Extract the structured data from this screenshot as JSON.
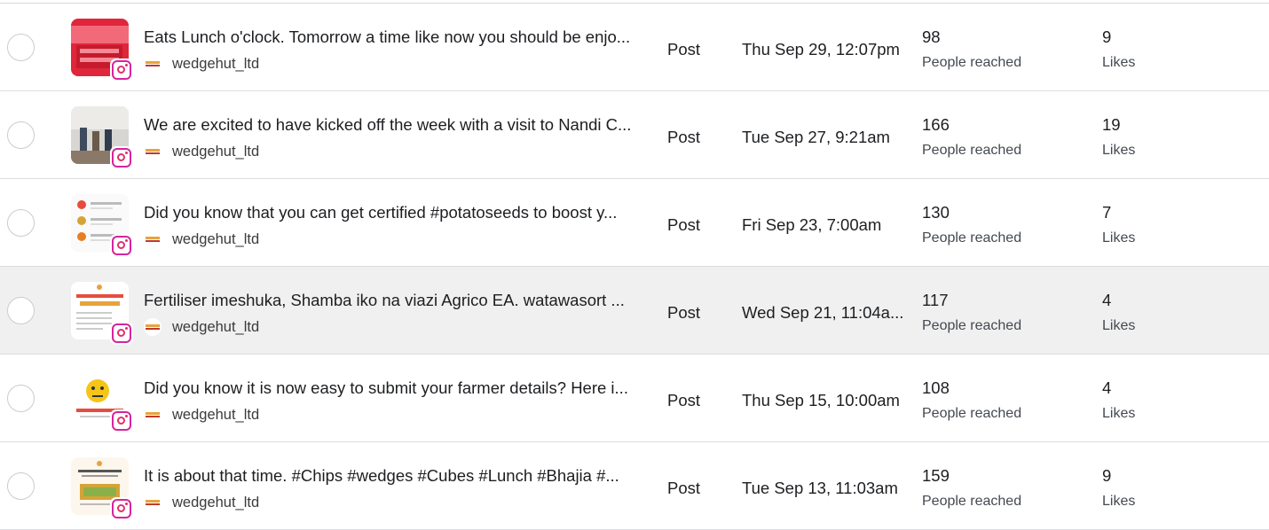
{
  "rows": [
    {
      "caption": "Eats Lunch o'clock. Tomorrow a time like now you should be enjo...",
      "account": "wedgehut_ltd",
      "type": "Post",
      "date": "Thu Sep 29, 12:07pm",
      "reach": "98",
      "reach_label": "People reached",
      "likes": "9",
      "likes_label": "Likes",
      "thumb": "thumb-red-crates",
      "highlight": false
    },
    {
      "caption": "We are excited to have kicked off the week with a visit to Nandi C...",
      "account": "wedgehut_ltd",
      "type": "Post",
      "date": "Tue Sep 27, 9:21am",
      "reach": "166",
      "reach_label": "People reached",
      "likes": "19",
      "likes_label": "Likes",
      "thumb": "thumb-room-visit",
      "highlight": false
    },
    {
      "caption": "Did you know that you can get certified #potatoseeds to boost y...",
      "account": "wedgehut_ltd",
      "type": "Post",
      "date": "Fri Sep 23, 7:00am",
      "reach": "130",
      "reach_label": "People reached",
      "likes": "7",
      "likes_label": "Likes",
      "thumb": "thumb-infographic",
      "highlight": false
    },
    {
      "caption": "Fertiliser imeshuka, Shamba iko na viazi Agrico EA. watawasort ...",
      "account": "wedgehut_ltd",
      "type": "Post",
      "date": "Wed Sep 21, 11:04a...",
      "reach": "117",
      "reach_label": "People reached",
      "likes": "4",
      "likes_label": "Likes",
      "thumb": "thumb-contracted-farmers",
      "highlight": true
    },
    {
      "caption": "Did you know it is now easy to submit your farmer details? Here i...",
      "account": "wedgehut_ltd",
      "type": "Post",
      "date": "Thu Sep 15, 10:00am",
      "reach": "108",
      "reach_label": "People reached",
      "likes": "4",
      "likes_label": "Likes",
      "thumb": "thumb-emoji-poster",
      "highlight": false
    },
    {
      "caption": "It is about that time. #Chips #wedges #Cubes #Lunch #Bhajia #...",
      "account": "wedgehut_ltd",
      "type": "Post",
      "date": "Tue Sep 13, 11:03am",
      "reach": "159",
      "reach_label": "People reached",
      "likes": "9",
      "likes_label": "Likes",
      "thumb": "thumb-menu-poster",
      "highlight": false
    }
  ],
  "platform_icon": "instagram-icon",
  "colors": {
    "instagram": "#d6249f",
    "row_highlight": "#f0f0f0",
    "divider": "#dadde1"
  }
}
